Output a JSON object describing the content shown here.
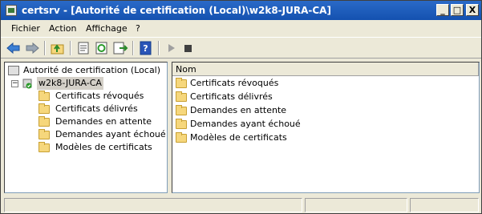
{
  "window": {
    "title": "certsrv - [Autorité de certification (Local)\\w2k8-JURA-CA]",
    "minimize": "_",
    "maximize": "□",
    "close": "X"
  },
  "menu": {
    "items": [
      {
        "label": "Fichier"
      },
      {
        "label": "Action"
      },
      {
        "label": "Affichage"
      },
      {
        "label": "?"
      }
    ]
  },
  "tree": {
    "root": "Autorité de certification (Local)",
    "ca_node": "w2k8-JURA-CA",
    "expander": "−",
    "children": [
      {
        "label": "Certificats révoqués"
      },
      {
        "label": "Certificats délivrés"
      },
      {
        "label": "Demandes en attente"
      },
      {
        "label": "Demandes ayant échoué"
      },
      {
        "label": "Modèles de certificats"
      }
    ]
  },
  "list": {
    "column": "Nom",
    "rows": [
      {
        "label": "Certificats révoqués"
      },
      {
        "label": "Certificats délivrés"
      },
      {
        "label": "Demandes en attente"
      },
      {
        "label": "Demandes ayant échoué"
      },
      {
        "label": "Modèles de certificats"
      }
    ]
  },
  "icons": {
    "toolbar": [
      "back-arrow-icon",
      "forward-arrow-icon",
      "up-folder-icon",
      "properties-icon",
      "refresh-icon",
      "export-list-icon",
      "help-icon",
      "start-service-icon",
      "stop-service-icon"
    ]
  },
  "colors": {
    "titlebar": "#1451b0",
    "selection": "#d4d0c8",
    "folder": "#f6d77c"
  }
}
